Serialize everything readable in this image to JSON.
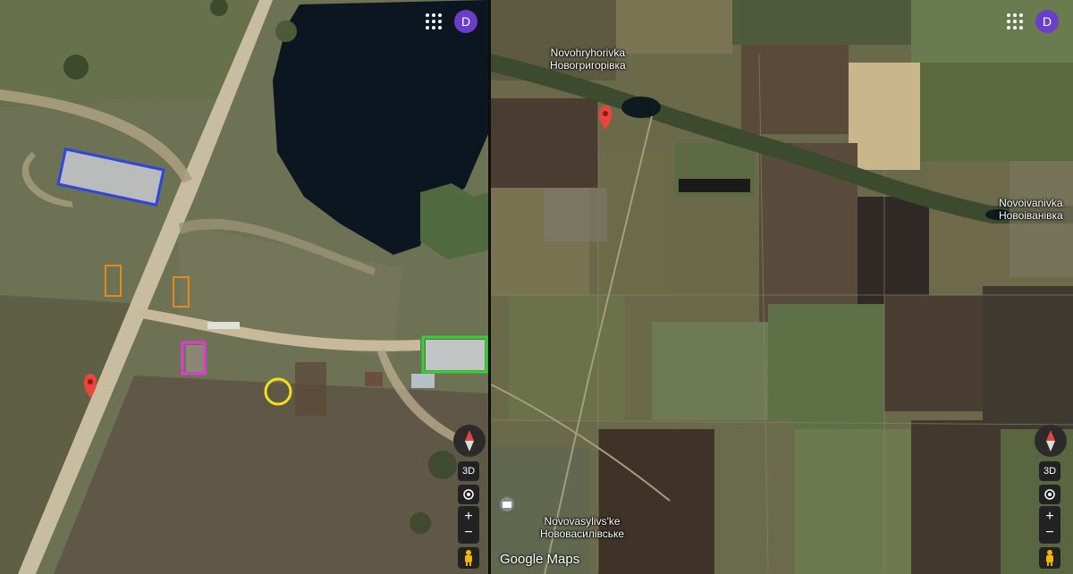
{
  "colors": {
    "avatar": "#6a3ec7",
    "marker": "#e8453c",
    "box_blue": "#2e46e0",
    "box_orange": "#e28a1c",
    "box_magenta": "#e23ad6",
    "box_green": "#2fd62f",
    "circle_yellow": "#f2e01b"
  },
  "left_pane": {
    "avatar_letter": "D",
    "icons": {
      "apps": "apps-grid-icon",
      "compass": "compass-icon",
      "locate": "locate-icon",
      "pegman": "pegman-icon"
    },
    "controls": {
      "three_d": "3D",
      "zoom_in": "+",
      "zoom_out": "−"
    }
  },
  "right_pane": {
    "avatar_letter": "D",
    "controls": {
      "three_d": "3D",
      "zoom_in": "+",
      "zoom_out": "−"
    },
    "places": {
      "novohryhorivka_latin": "Novohryhorivka",
      "novohryhorivka_cyrillic": "Новогригорівка",
      "novoivanivka_latin": "Novoivanivka",
      "novoivanivka_cyrillic": "Новоіванівка",
      "novovasylivske_latin": "Novovasylivs'ke",
      "novovasylivske_cyrillic": "Нововасилівське"
    },
    "brand": "Google Maps"
  }
}
